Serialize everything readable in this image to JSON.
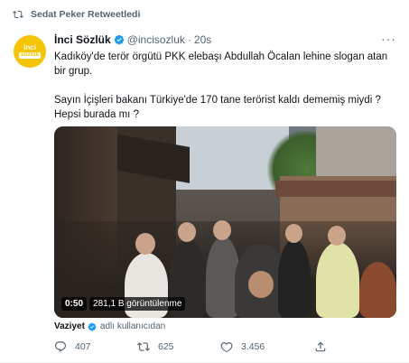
{
  "retweet": {
    "label": "Sedat Peker Retweetledi"
  },
  "author": {
    "avatar_top": "inci",
    "avatar_bottom": "sözlük",
    "name": "İnci Sözlük",
    "handle": "@incisozluk",
    "separator": "·",
    "time": "20s",
    "more": "···"
  },
  "tweet": {
    "paragraph1": "Kadıköy'de terör örgütü PKK elebaşı Abdullah Öcalan lehine slogan atan bir grup.",
    "paragraph2": "Sayın İçişleri bakanı Türkiye'de 170 tane terörist kaldı dememiş miydi ? Hepsi burada mı ?"
  },
  "video": {
    "duration": "0:50",
    "views": "281,1 B görüntülenme"
  },
  "caption": {
    "source": "Vaziyet",
    "suffix": "adlı kullanıcıdan"
  },
  "actions": {
    "reply_count": "407",
    "retweet_count": "625",
    "like_count": "3.456"
  },
  "colors": {
    "accent": "#1d9bf0",
    "avatar_bg": "#f5c400",
    "muted": "#536471"
  },
  "icons": [
    "retweet-icon",
    "verified-icon",
    "more-icon",
    "reply-icon",
    "like-icon",
    "share-icon"
  ]
}
